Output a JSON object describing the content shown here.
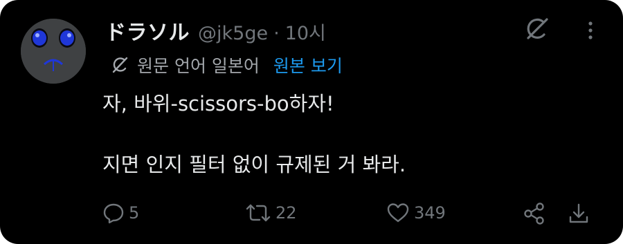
{
  "post": {
    "display_name": "ドラソル",
    "handle": "@jk5ge",
    "separator": "·",
    "time": "10시",
    "translation": {
      "source_language": "원문 언어 일본어",
      "show_original": "원본 보기"
    },
    "text_line1": "자, 바위-scissors-bo하자!",
    "text_line2": "지면 인지 필터 없이 규제된 거 봐라."
  },
  "actions": {
    "reply_count": "5",
    "repost_count": "22",
    "like_count": "349"
  },
  "colors": {
    "background": "#000000",
    "text": "#e7e9ea",
    "muted": "#71767b",
    "link": "#1d9bf0"
  },
  "icons": [
    "grok-icon",
    "more-icon",
    "translate-icon",
    "reply-icon",
    "repost-icon",
    "like-icon",
    "share-icon",
    "download-icon"
  ]
}
